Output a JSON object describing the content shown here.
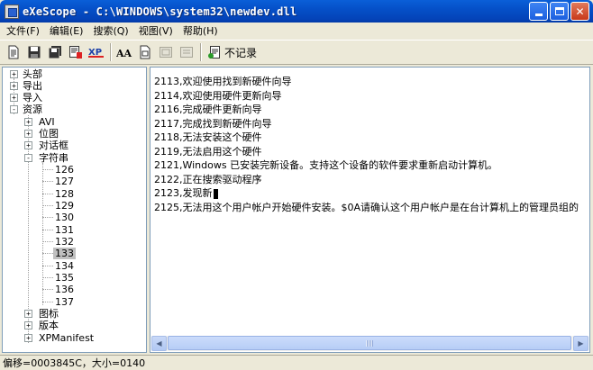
{
  "window": {
    "title": "eXeScope - C:\\WINDOWS\\system32\\newdev.dll",
    "min_glyph": "minimize",
    "max_glyph": "maximize",
    "close_glyph": "✕"
  },
  "menu": {
    "items": [
      "文件(F)",
      "编辑(E)",
      "搜索(Q)",
      "视图(V)",
      "帮助(H)"
    ]
  },
  "toolbar": {
    "no_record_label": "不记录",
    "icons": [
      "new-file-icon",
      "save-icon",
      "save-all-icon",
      "export-icon",
      "xp-style-icon",
      "font-icon",
      "resource-icon",
      "disabled-icon-1",
      "disabled-icon-2",
      "no-record-icon"
    ]
  },
  "tree": {
    "nodes": [
      {
        "label": "头部",
        "expander": "+"
      },
      {
        "label": "导出",
        "expander": "+"
      },
      {
        "label": "导入",
        "expander": "+"
      },
      {
        "label": "资源",
        "expander": "-"
      },
      {
        "label": "AVI",
        "expander": "+"
      },
      {
        "label": "位图",
        "expander": "+"
      },
      {
        "label": "对话框",
        "expander": "+"
      },
      {
        "label": "字符串",
        "expander": "-"
      },
      {
        "label": "126"
      },
      {
        "label": "127"
      },
      {
        "label": "128"
      },
      {
        "label": "129"
      },
      {
        "label": "130"
      },
      {
        "label": "131"
      },
      {
        "label": "132"
      },
      {
        "label": "133",
        "selected": true
      },
      {
        "label": "134"
      },
      {
        "label": "135"
      },
      {
        "label": "136"
      },
      {
        "label": "137"
      },
      {
        "label": "图标",
        "expander": "+"
      },
      {
        "label": "版本",
        "expander": "+"
      },
      {
        "label": "XPManifest",
        "expander": "+"
      }
    ]
  },
  "content": {
    "lines": [
      "2113,欢迎使用找到新硬件向导",
      "2114,欢迎使用硬件更新向导",
      "2116,完成硬件更新向导",
      "2117,完成找到新硬件向导",
      "2118,无法安装这个硬件",
      "2119,无法启用这个硬件",
      "2121,Windows 已安装完新设备。支持这个设备的软件要求重新启动计算机。",
      "2122,正在搜索驱动程序",
      "2123,发现新",
      "2125,无法用这个用户帐户开始硬件安装。$0A请确认这个用户帐户是在台计算机上的管理员组的"
    ]
  },
  "status": {
    "text": "偏移=0003845C，大小=0140"
  }
}
